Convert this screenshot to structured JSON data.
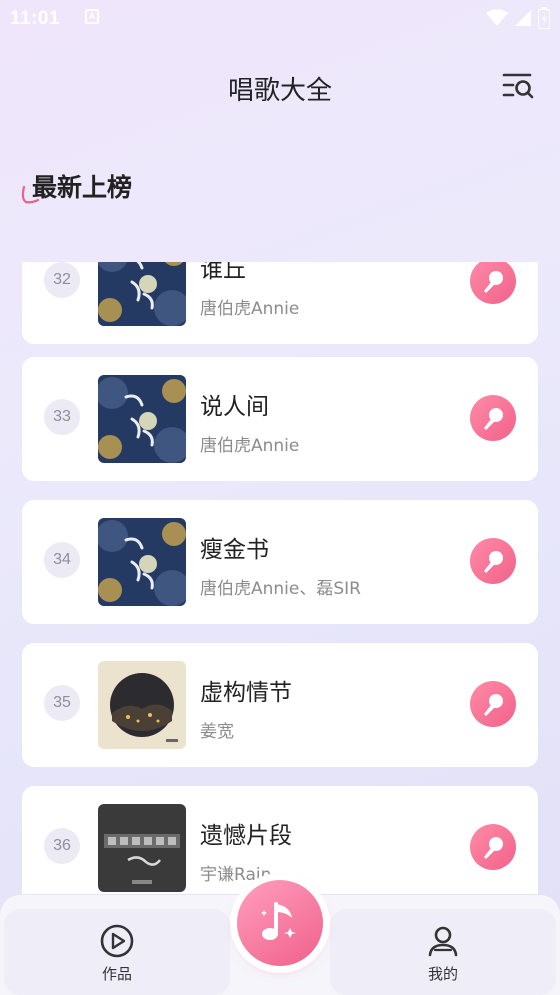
{
  "status_bar": {
    "time": "11:01",
    "notification_letter": "A"
  },
  "header": {
    "title": "唱歌大全",
    "menu_icon": "list-search-icon"
  },
  "banner": {
    "title": "最新上榜"
  },
  "songs": [
    {
      "rank": "32",
      "title": "谁丘",
      "artist": "唐伯虎Annie",
      "cover": "night-flower-cover"
    },
    {
      "rank": "33",
      "title": "说人间",
      "artist": "唐伯虎Annie",
      "cover": "night-flower-cover"
    },
    {
      "rank": "34",
      "title": "瘦金书",
      "artist": "唐伯虎Annie、磊SIR",
      "cover": "night-flower-cover"
    },
    {
      "rank": "35",
      "title": "虚构情节",
      "artist": "姜宽",
      "cover": "city-circle-cover"
    },
    {
      "rank": "36",
      "title": "遗憾片段",
      "artist": "宇谦Rain",
      "cover": "gray-text-cover"
    }
  ],
  "tabs": {
    "works": "作品",
    "mine": "我的"
  },
  "colors": {
    "accent_pink": "#f2628a",
    "card_bg": "#ffffff"
  }
}
